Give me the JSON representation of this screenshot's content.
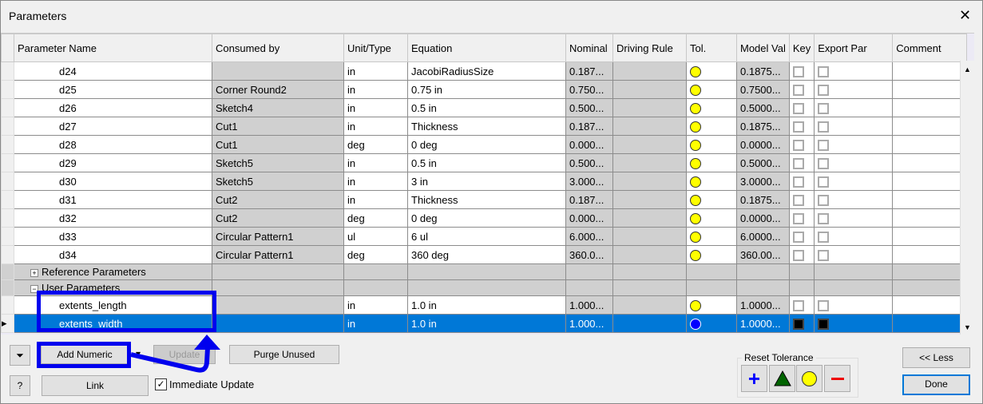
{
  "window": {
    "title": "Parameters"
  },
  "columns": [
    "Parameter Name",
    "Consumed by",
    "Unit/Type",
    "Equation",
    "Nominal",
    "Driving Rule",
    "Tol.",
    "Model Val",
    "Key",
    "Export Par",
    "Comment"
  ],
  "rows": [
    {
      "name": "d24",
      "consumed": "",
      "unit": "in",
      "equation": "JacobiRadiusSize",
      "nominal": "0.187...",
      "model": "0.1875..."
    },
    {
      "name": "d25",
      "consumed": "Corner Round2",
      "unit": "in",
      "equation": "0.75 in",
      "nominal": "0.750...",
      "model": "0.7500..."
    },
    {
      "name": "d26",
      "consumed": "Sketch4",
      "unit": "in",
      "equation": "0.5 in",
      "nominal": "0.500...",
      "model": "0.5000..."
    },
    {
      "name": "d27",
      "consumed": "Cut1",
      "unit": "in",
      "equation": "Thickness",
      "nominal": "0.187...",
      "model": "0.1875..."
    },
    {
      "name": "d28",
      "consumed": "Cut1",
      "unit": "deg",
      "equation": "0 deg",
      "nominal": "0.000...",
      "model": "0.0000..."
    },
    {
      "name": "d29",
      "consumed": "Sketch5",
      "unit": "in",
      "equation": "0.5 in",
      "nominal": "0.500...",
      "model": "0.5000..."
    },
    {
      "name": "d30",
      "consumed": "Sketch5",
      "unit": "in",
      "equation": "3 in",
      "nominal": "3.000...",
      "model": "3.0000..."
    },
    {
      "name": "d31",
      "consumed": "Cut2",
      "unit": "in",
      "equation": "Thickness",
      "nominal": "0.187...",
      "model": "0.1875..."
    },
    {
      "name": "d32",
      "consumed": "Cut2",
      "unit": "deg",
      "equation": "0 deg",
      "nominal": "0.000...",
      "model": "0.0000..."
    },
    {
      "name": "d33",
      "consumed": "Circular Pattern1",
      "unit": "ul",
      "equation": "6 ul",
      "nominal": "6.000...",
      "model": "6.0000..."
    },
    {
      "name": "d34",
      "consumed": "Circular Pattern1",
      "unit": "deg",
      "equation": "360 deg",
      "nominal": "360.0...",
      "model": "360.00..."
    }
  ],
  "groups": {
    "reference": "Reference Parameters",
    "user": "User Parameters"
  },
  "user_rows": [
    {
      "name": "extents_length",
      "unit": "in",
      "equation": "1.0 in",
      "nominal": "1.000...",
      "model": "1.0000...",
      "selected": false
    },
    {
      "name": "extents_width",
      "unit": "in",
      "equation": "1.0 in",
      "nominal": "1.000...",
      "model": "1.0000...",
      "selected": true
    }
  ],
  "buttons": {
    "add_numeric": "Add Numeric",
    "update": "Update",
    "purge": "Purge Unused",
    "link": "Link",
    "immediate_update": "Immediate Update",
    "less": "<< Less",
    "done": "Done"
  },
  "immediate_update_checked": true,
  "reset_tolerance": {
    "label": "Reset Tolerance",
    "icons": [
      "plus-icon",
      "triangle-icon",
      "circle-icon",
      "minus-icon"
    ]
  },
  "colors": {
    "highlight": "#0000ee",
    "selection": "#0078d7",
    "tol_yellow": "#ffff00"
  }
}
